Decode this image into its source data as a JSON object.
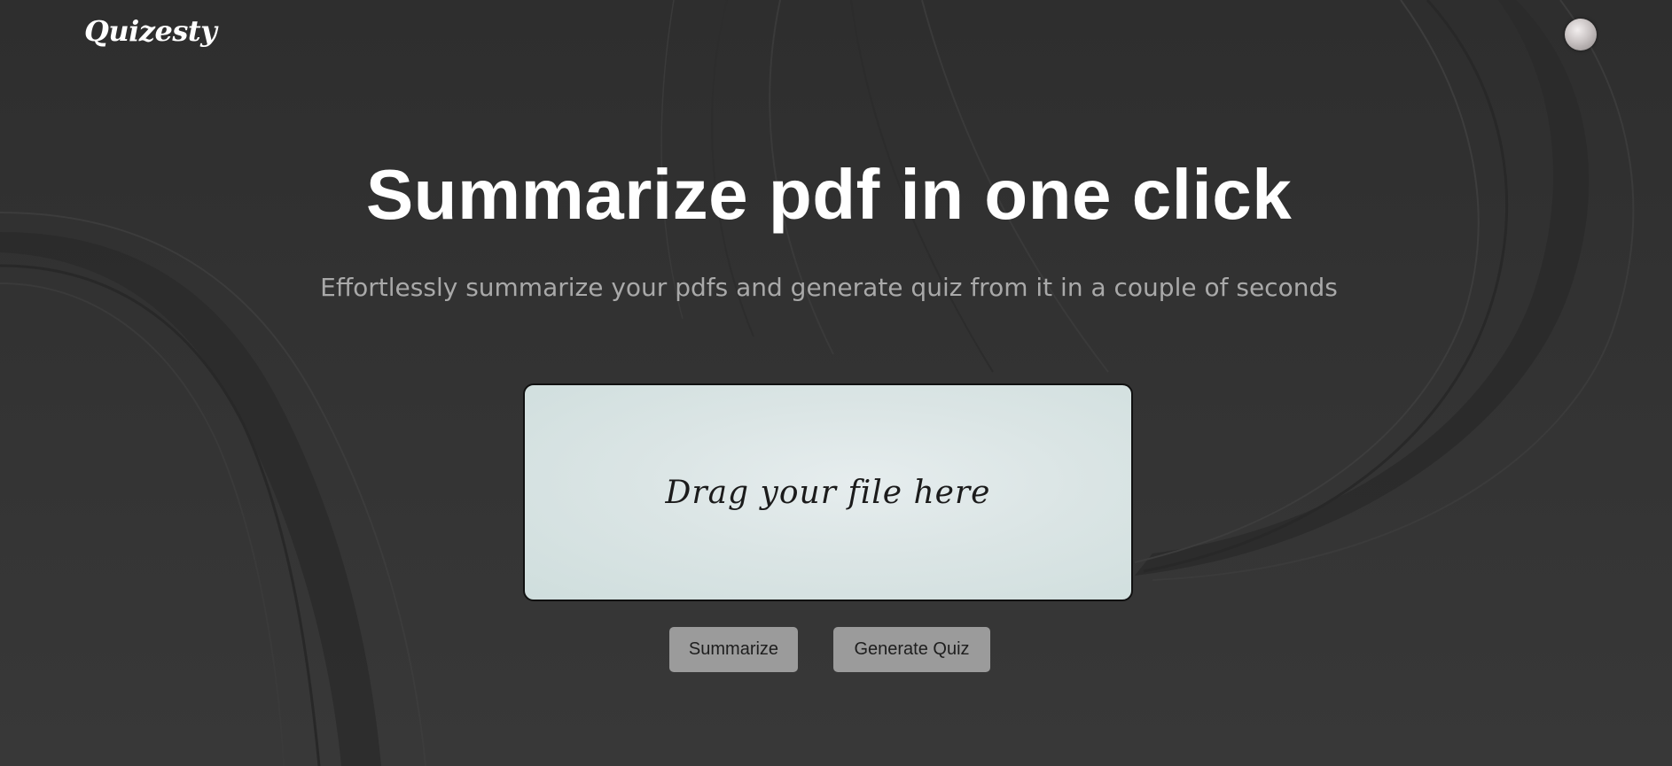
{
  "header": {
    "logo_text": "Quizesty",
    "avatar_icon": "user-avatar"
  },
  "hero": {
    "title": "Summarize pdf in one click",
    "subtitle": "Effortlessly summarize your pdfs and generate quiz from it in a couple of seconds"
  },
  "upload": {
    "label": "Drag your file here"
  },
  "actions": {
    "summarize_label": "Summarize",
    "generate_quiz_label": "Generate Quiz"
  },
  "colors": {
    "background": "#333333",
    "title": "#ffffff",
    "subtitle": "#a9a9a9",
    "dropzone_bg": "#dbe5e5",
    "button_bg": "#9b9b9b"
  }
}
